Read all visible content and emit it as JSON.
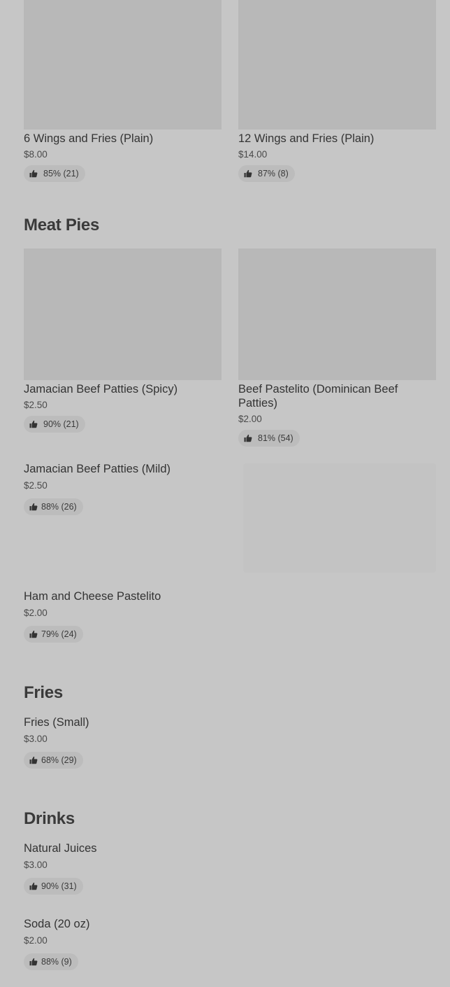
{
  "sections": {
    "meat_pies": "Meat Pies",
    "fries": "Fries",
    "drinks": "Drinks"
  },
  "items": {
    "wings6": {
      "name": "6 Wings and Fries (Plain)",
      "price": "$8.00",
      "rating": "85% (21)"
    },
    "wings12": {
      "name": "12 Wings and Fries (Plain)",
      "price": "$14.00",
      "rating": "87% (8)"
    },
    "jam_spicy": {
      "name": "Jamacian Beef Patties (Spicy)",
      "price": "$2.50",
      "rating": "90% (21)"
    },
    "pastelito": {
      "name": "Beef Pastelito (Dominican Beef Patties)",
      "price": "$2.00",
      "rating": "81% (54)"
    },
    "jam_mild": {
      "name": "Jamacian Beef Patties (Mild)",
      "price": "$2.50",
      "rating": "88% (26)"
    },
    "ham_cheese": {
      "name": "Ham and Cheese Pastelito",
      "price": "$2.00",
      "rating": "79% (24)"
    },
    "fries_small": {
      "name": "Fries (Small)",
      "price": "$3.00",
      "rating": "68% (29)"
    },
    "juices": {
      "name": "Natural Juices",
      "price": "$3.00",
      "rating": "90% (31)"
    },
    "soda": {
      "name": "Soda (20 oz)",
      "price": "$2.00",
      "rating": "88% (9)"
    }
  },
  "icons": {
    "rating": "thumbs-up-icon"
  },
  "colors": {
    "background": "#c6c6c6",
    "image_placeholder": "#b8b8b8",
    "badge": "#bcbcbc",
    "text": "#333333"
  }
}
